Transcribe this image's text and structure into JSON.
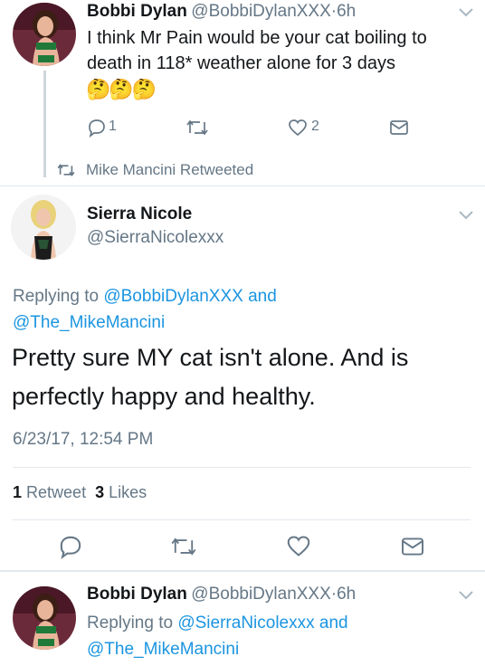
{
  "tweet1": {
    "name": "Bobbi Dylan",
    "handle": "@BobbiDylanXXX",
    "dot": "·",
    "time": "6h",
    "text": "I think Mr Pain would be your cat boiling to death in 118* weather alone for 3 days",
    "emoji": "🤔🤔🤔",
    "reply_count": "1",
    "like_count": "2"
  },
  "retweet_context": {
    "label": "Mike Mancini Retweeted"
  },
  "main_tweet": {
    "name": "Sierra Nicole",
    "handle": "@SierraNicolexxx",
    "replying_prefix": "Replying to",
    "reply_user1": "@BobbiDylanXXX",
    "and": "and",
    "reply_user2": "@The_MikeMancini",
    "text": "Pretty sure MY cat isn't alone. And is perfectly happy and healthy.",
    "timestamp": "6/23/17, 12:54 PM",
    "retweets_count": "1",
    "retweets_label": "Retweet",
    "likes_count": "3",
    "likes_label": "Likes"
  },
  "tweet3": {
    "name": "Bobbi Dylan",
    "handle": "@BobbiDylanXXX",
    "dot": "·",
    "time": "6h",
    "replying_prefix": "Replying to",
    "reply_user1": "@SierraNicolexxx",
    "and": "and",
    "reply_user2": "@The_MikeMancini"
  },
  "colors": {
    "accent": "#1b95e0",
    "secondary_text": "#657786",
    "divider": "#e1e8ed"
  }
}
